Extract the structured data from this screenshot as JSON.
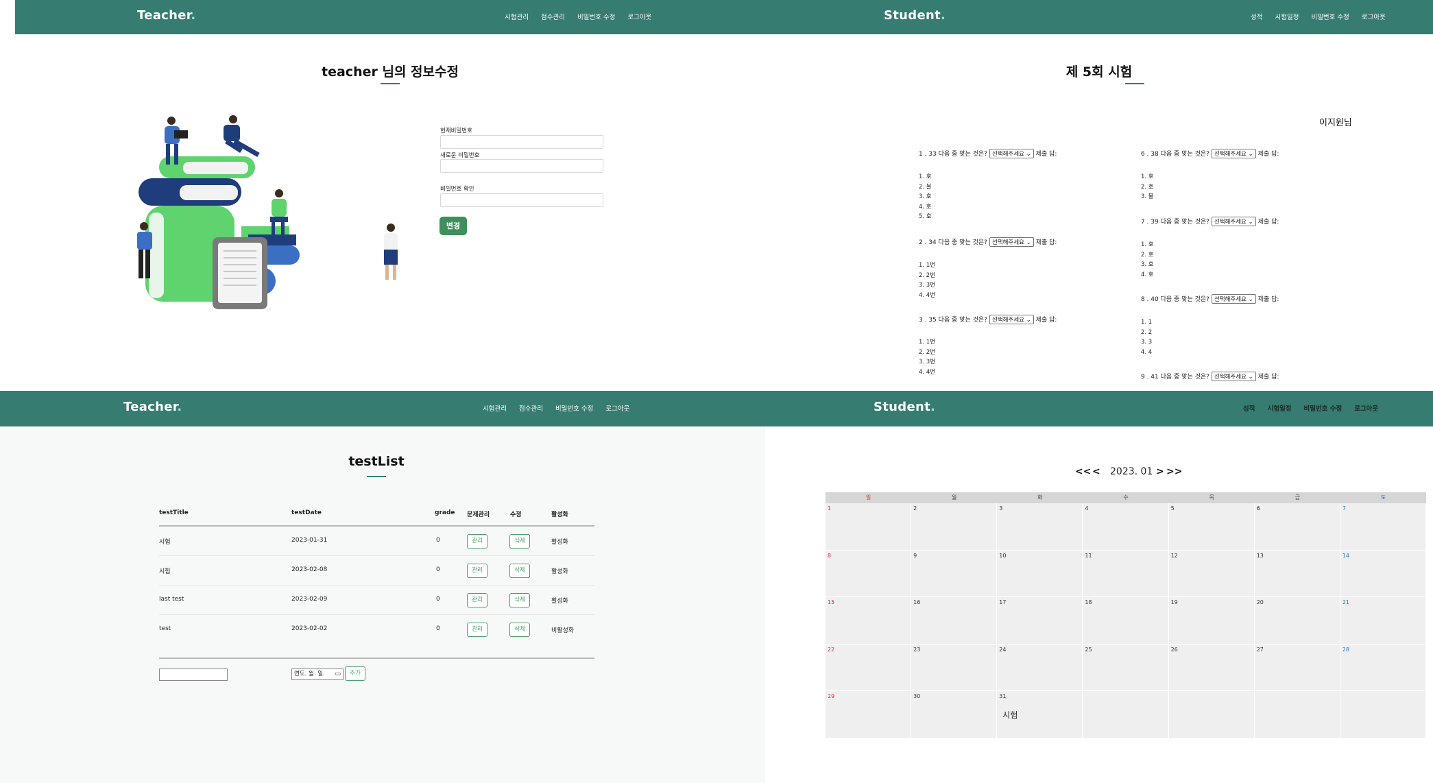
{
  "teacher_account": {
    "brand": "Teacher",
    "menu": [
      "시험관리",
      "점수관리",
      "비밀번호 수정",
      "로그아웃"
    ],
    "title": "teacher 님의 정보수정",
    "fields": [
      {
        "label": "현재비밀번호",
        "value": ""
      },
      {
        "label": "새로운 비밀번호",
        "value": ""
      },
      {
        "label": "비밀번호 확인",
        "value": ""
      }
    ],
    "submit_label": "변경"
  },
  "student_exam": {
    "brand": "Student",
    "menu": [
      "성적",
      "시험일정",
      "비밀번호 수정",
      "로그아웃"
    ],
    "title": "제 5회 시험",
    "user": "이지원님",
    "select_placeholder": "선택해주세요",
    "answer_label": "제출 답:",
    "questions": [
      {
        "text": "1 . 33 다음 중 맞는 것은?",
        "options": [
          "1. 호",
          "2. 불",
          "3. 호",
          "4. 호",
          "5. 호"
        ]
      },
      {
        "text": "2 . 34 다음 중 맞는 것은?",
        "options": [
          "1. 1번",
          "2. 2번",
          "3. 3번",
          "4. 4번"
        ]
      },
      {
        "text": "3 . 35 다음 중 맞는 것은?",
        "options": [
          "1. 1번",
          "2. 2번",
          "3. 3번",
          "4. 4번"
        ]
      },
      {
        "text": "6 . 38 다음 중 맞는 것은?",
        "options": [
          "1. 호",
          "2. 호",
          "3. 불"
        ]
      },
      {
        "text": "7 . 39 다음 중 맞는 것은?",
        "options": [
          "1. 호",
          "2. 호",
          "3. 호",
          "4. 호"
        ]
      },
      {
        "text": "8 . 40 다음 중 맞는 것은?",
        "options": [
          "1. 1",
          "2. 2",
          "3. 3",
          "4. 4"
        ]
      },
      {
        "text": "9 . 41 다음 중 맞는 것은?",
        "options": []
      }
    ]
  },
  "teacher_tests": {
    "brand": "Teacher",
    "menu": [
      "시험관리",
      "점수관리",
      "비밀번호 수정",
      "로그아웃"
    ],
    "title": "testList",
    "columns": [
      "testTitle",
      "testDate",
      "grade",
      "문제관리",
      "수정",
      "활성화"
    ],
    "rows": [
      {
        "title": "시험",
        "date": "2023-01-31",
        "grade": "0",
        "manage": "관리",
        "edit": "삭제",
        "active": "활성화"
      },
      {
        "title": "시험",
        "date": "2023-02-08",
        "grade": "0",
        "manage": "관리",
        "edit": "삭제",
        "active": "활성화"
      },
      {
        "title": "last test",
        "date": "2023-02-09",
        "grade": "0",
        "manage": "관리",
        "edit": "삭제",
        "active": "활성화"
      },
      {
        "title": "test",
        "date": "2023-02-02",
        "grade": "0",
        "manage": "관리",
        "edit": "삭제",
        "active": "비활성화"
      }
    ],
    "new_title_value": "",
    "date_placeholder": "연도. 월. 일.",
    "add_label": "추가"
  },
  "student_calendar": {
    "brand": "Student",
    "menu": [
      "성적",
      "시험일정",
      "비밀번호 수정",
      "로그아웃"
    ],
    "nav": {
      "prev_year": "<<",
      "prev_month": "<",
      "next_month": ">",
      "next_year": ">>"
    },
    "month_label": "2023. 01",
    "weekdays": [
      "일",
      "월",
      "화",
      "수",
      "목",
      "금",
      "토"
    ],
    "days": [
      "1",
      "2",
      "3",
      "4",
      "5",
      "6",
      "7",
      "8",
      "9",
      "10",
      "11",
      "12",
      "13",
      "14",
      "15",
      "16",
      "17",
      "18",
      "19",
      "20",
      "21",
      "22",
      "23",
      "24",
      "25",
      "26",
      "27",
      "28",
      "29",
      "30",
      "31"
    ],
    "events": [
      {
        "day": "31",
        "label": "시험"
      }
    ]
  },
  "colors": {
    "nav": "#367c70",
    "accent_green": "#3f8f5a",
    "sunday": "#d9333a",
    "saturday": "#2e7ab8"
  }
}
